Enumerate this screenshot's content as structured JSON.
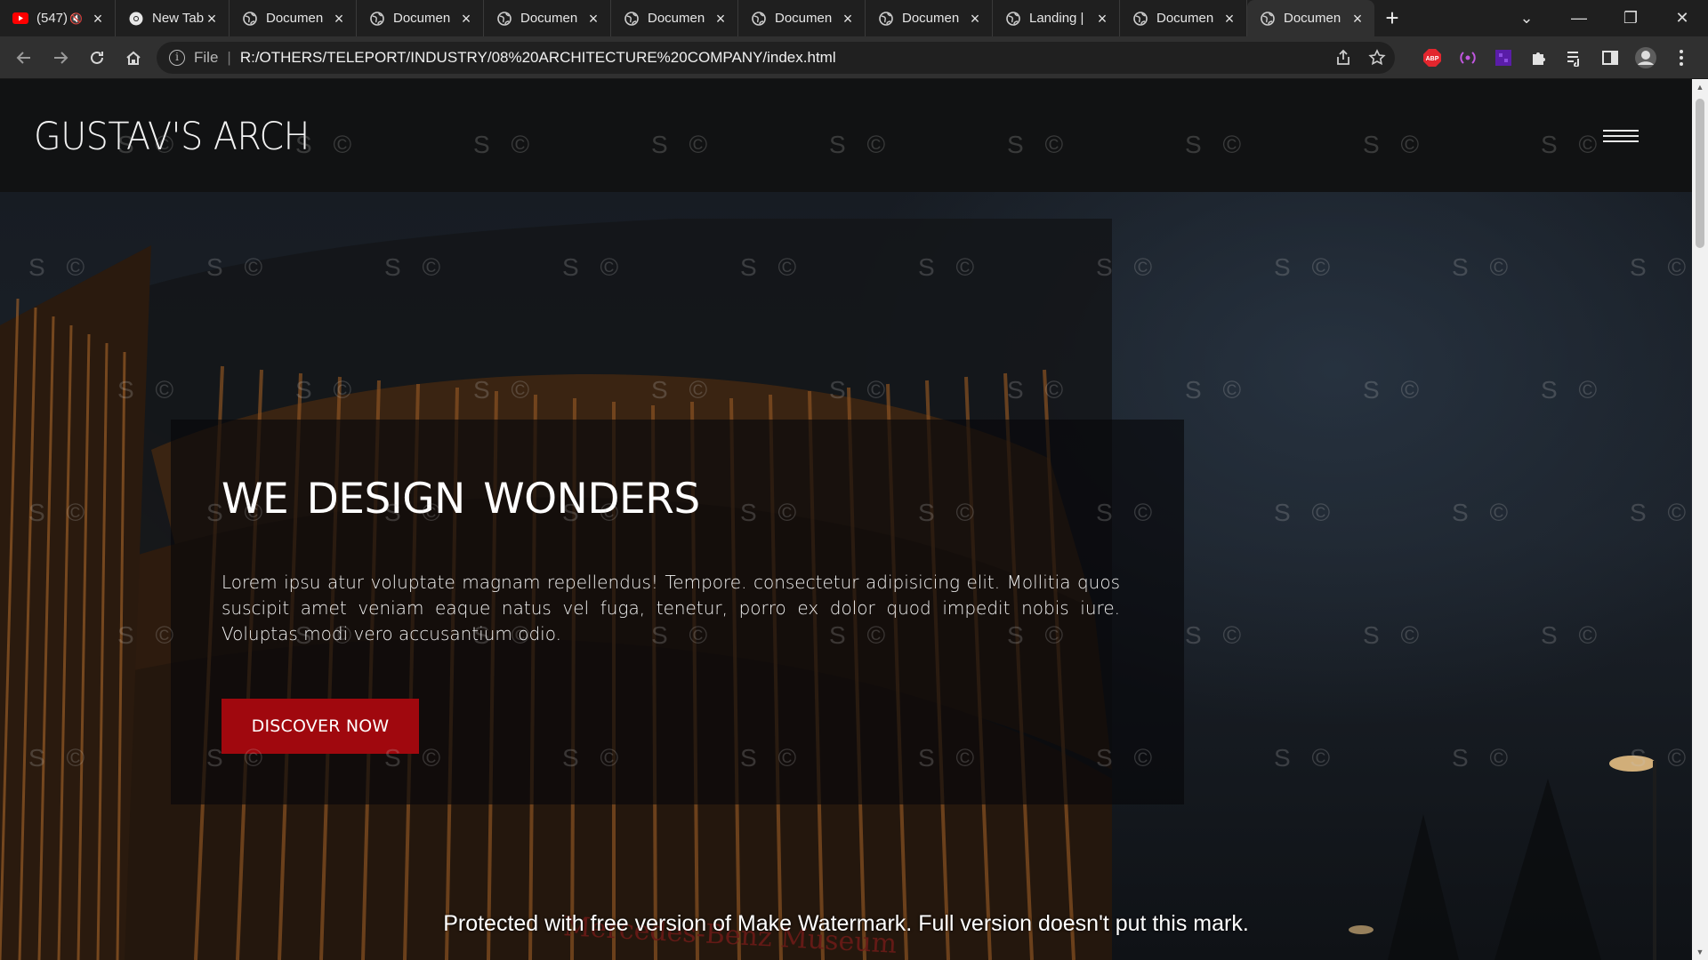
{
  "browser": {
    "tabs": [
      {
        "title": "(547)",
        "icon": "youtube-icon",
        "muted": true
      },
      {
        "title": "New Tab",
        "icon": "chrome-icon"
      },
      {
        "title": "Documen",
        "icon": "globe-icon"
      },
      {
        "title": "Documen",
        "icon": "globe-icon"
      },
      {
        "title": "Documen",
        "icon": "globe-icon"
      },
      {
        "title": "Documen",
        "icon": "globe-icon"
      },
      {
        "title": "Documen",
        "icon": "globe-icon"
      },
      {
        "title": "Documen",
        "icon": "globe-icon"
      },
      {
        "title": "Landing |",
        "icon": "globe-icon"
      },
      {
        "title": "Documen",
        "icon": "globe-icon"
      },
      {
        "title": "Documen",
        "icon": "globe-icon",
        "active": true
      }
    ],
    "omnibox": {
      "scheme": "File",
      "url": "R:/OTHERS/TELEPORT/INDUSTRY/08%20ARCHITECTURE%20COMPANY/index.html"
    },
    "extensions": [
      "adblock-icon",
      "broadcast-icon",
      "purple-app-icon",
      "puzzle-icon",
      "media-queue-icon",
      "side-panel-icon",
      "profile-avatar-icon",
      "kebab-menu-icon"
    ]
  },
  "site": {
    "logo": "GUSTAV'S ARCH",
    "hero": {
      "heading": "WE DESIGN WONDERS",
      "body": "Lorem ipsu atur voluptate magnam repellendus! Tempore. consectetur adipisicing elit. Mollitia quos suscipit amet veniam eaque natus vel fuga, tenetur, porro ex dolor quod impedit nobis iure. Voluptas modi vero accusantium odio.",
      "cta": "DISCOVER NOW"
    },
    "background_sign": "Mercedes-Benz Museum"
  },
  "watermark": {
    "mark": "S ©",
    "notice": "Protected with free version of Make Watermark. Full version doesn't put this mark."
  },
  "colors": {
    "accent": "#a0080e",
    "chrome_bg": "#1f1f1f",
    "toolbar_bg": "#303030",
    "nav_bg": "#111213"
  }
}
